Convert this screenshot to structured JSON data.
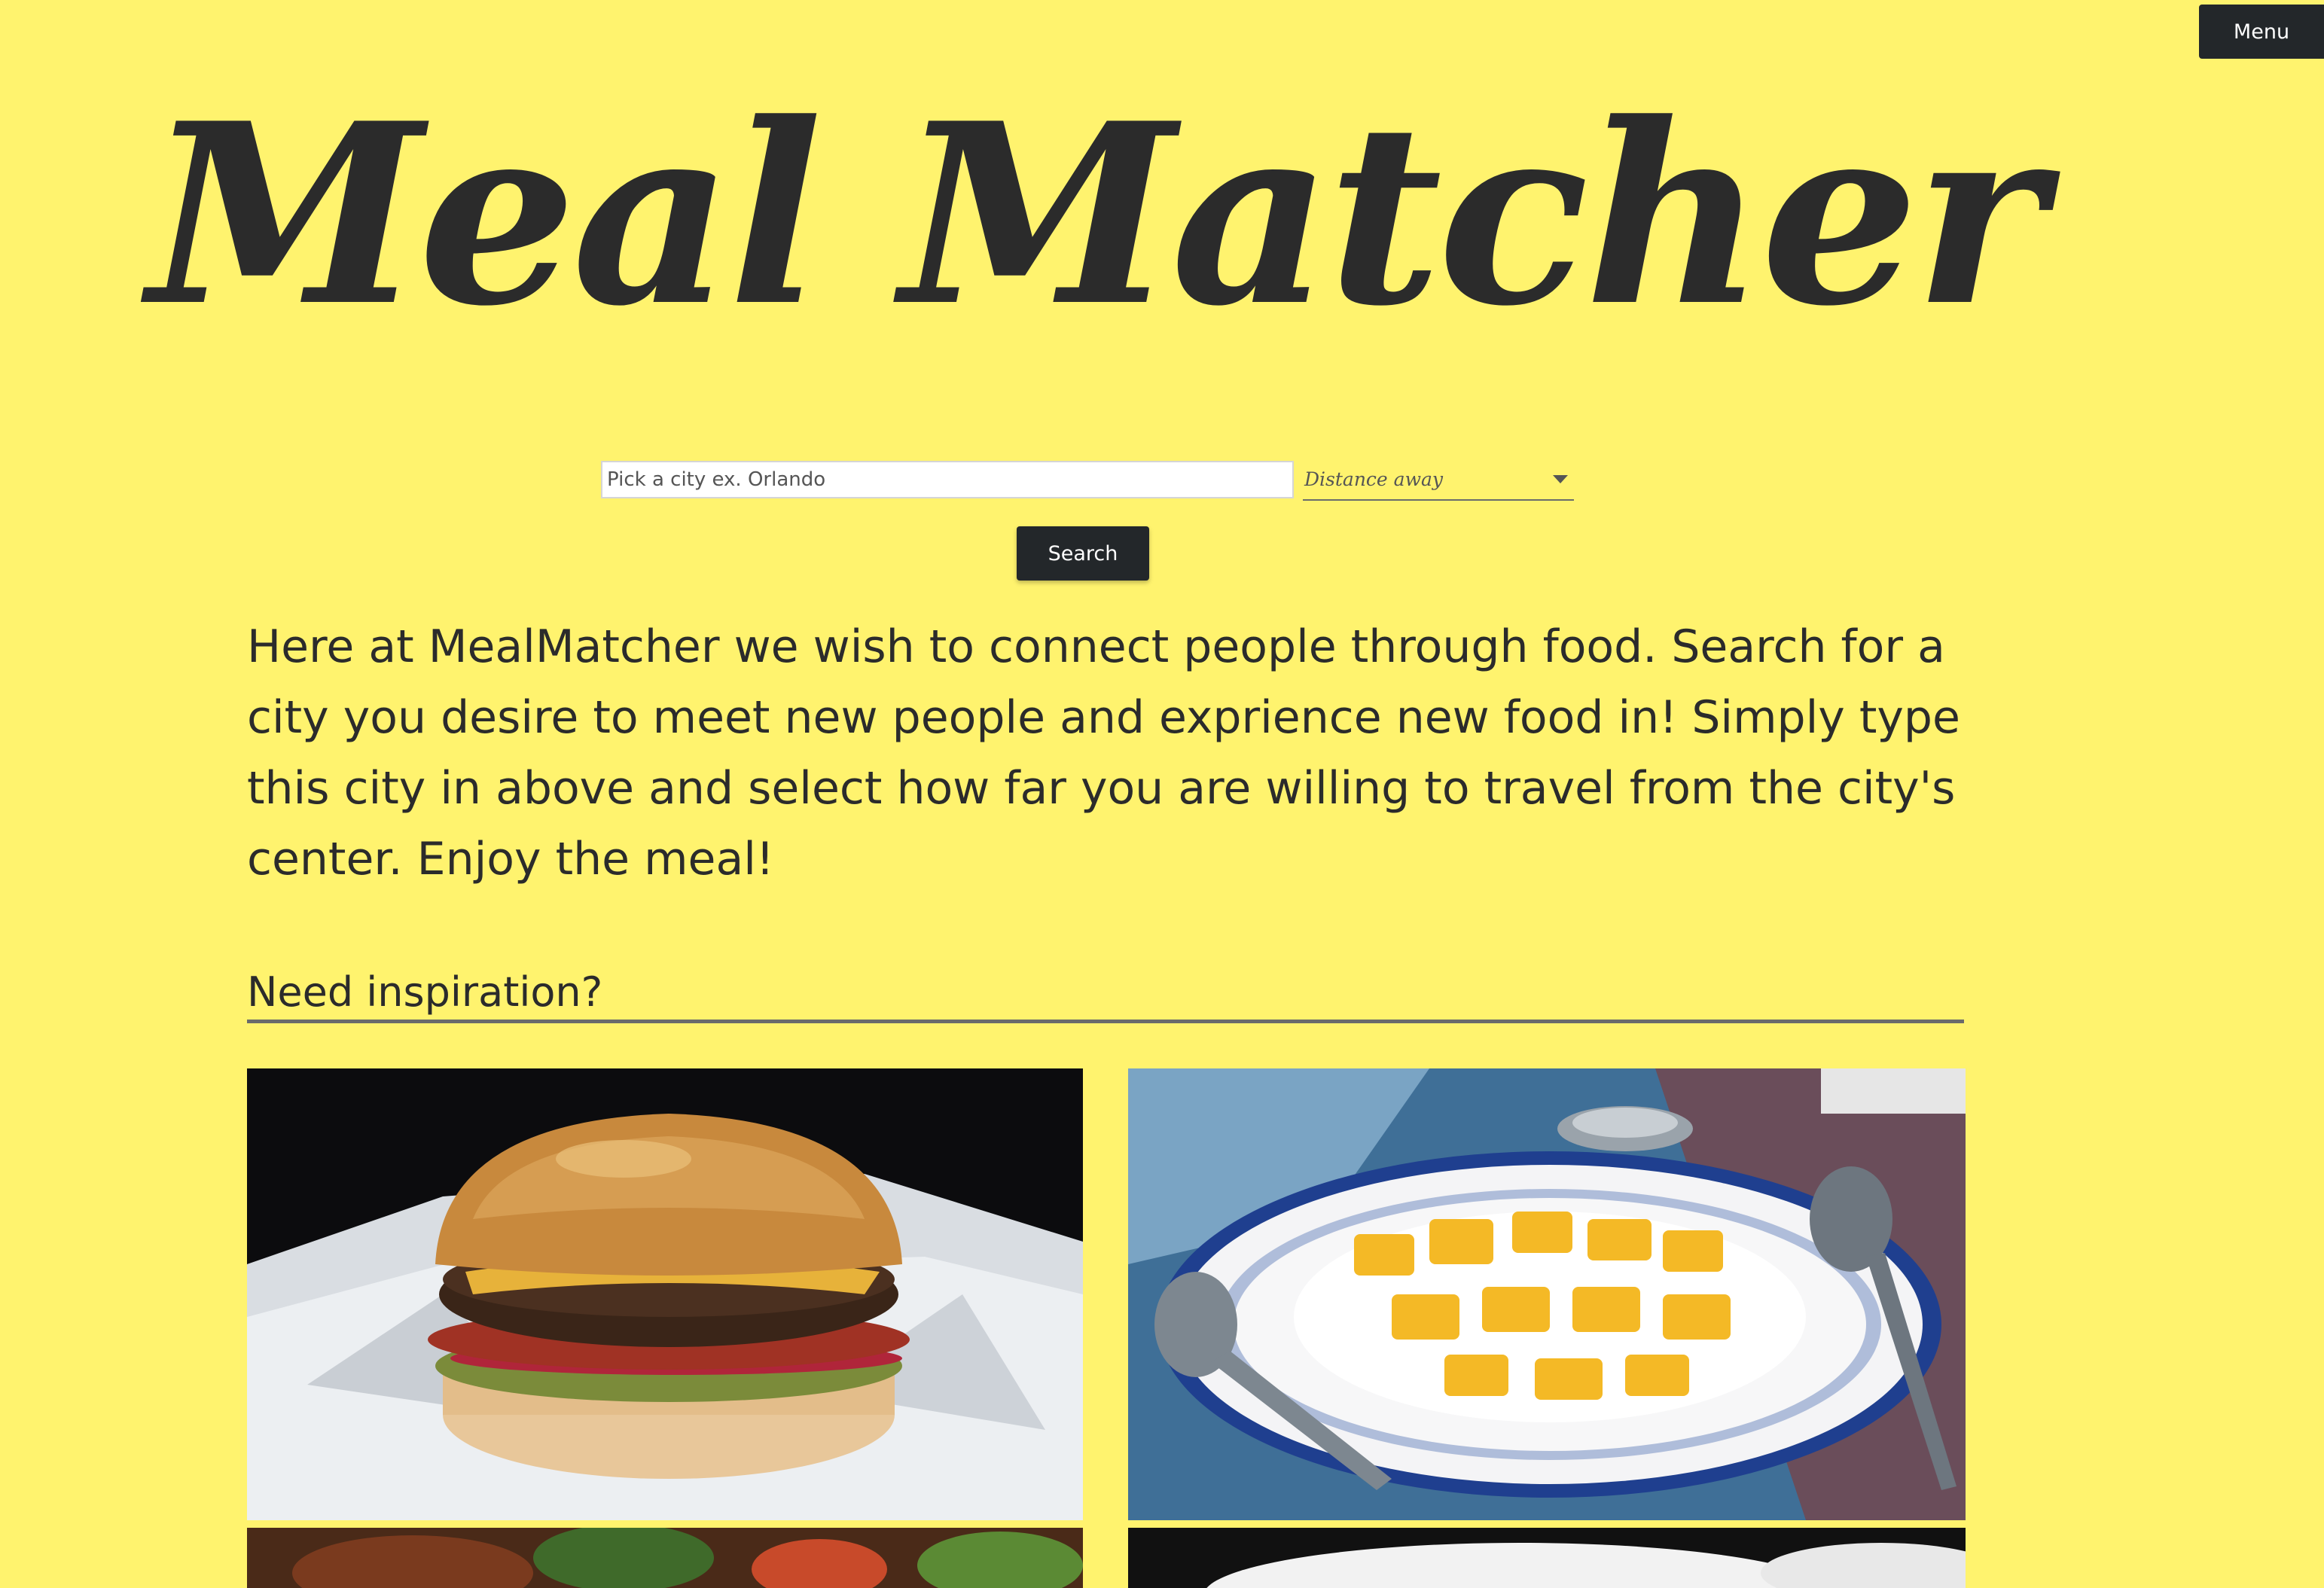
{
  "header": {
    "menu_label": "Menu",
    "title": "Meal Matcher"
  },
  "search": {
    "city_placeholder": "Pick a city ex. Orlando",
    "distance_label": "Distance away",
    "button_label": "Search"
  },
  "intro": {
    "text": "Here at MealMatcher we wish to connect people through food. Search for a city you desire to meet new people and exprience new food in! Simply type this city in above and select how far you are willing to travel from the city's center. Enjoy the meal!"
  },
  "inspiration": {
    "heading": "Need inspiration?"
  },
  "colors": {
    "background": "#fff36e",
    "dark": "#23272a",
    "text": "#2b2b2b"
  }
}
